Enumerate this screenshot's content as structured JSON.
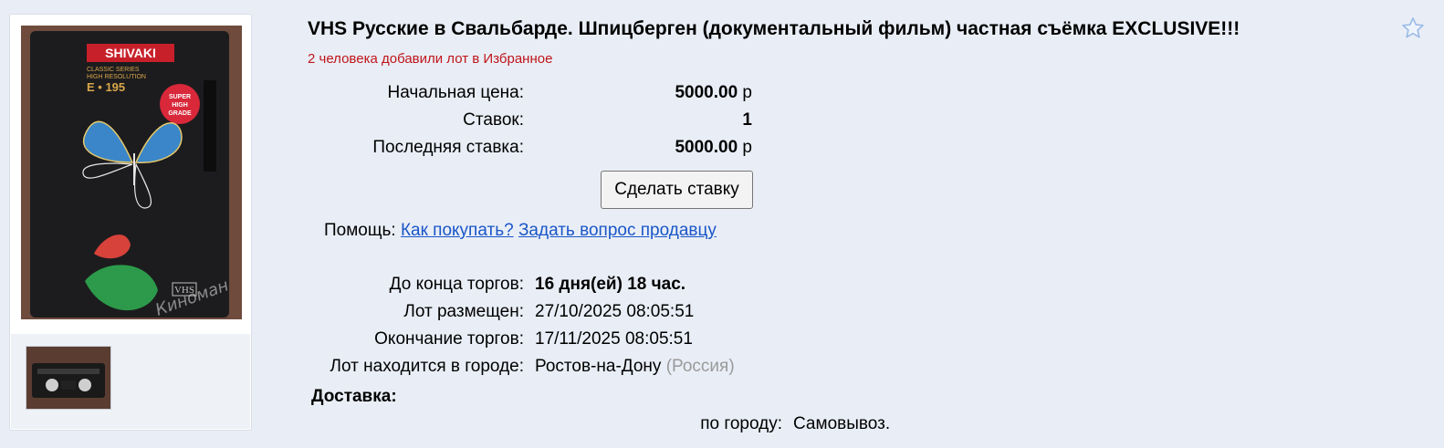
{
  "lot": {
    "title": "VHS Русские в Свальбарде. Шпицберген (документальный фильм) частная съёмка EXCLUSIVE!!!",
    "favorites_note": "2 человека добавили лот в Избранное"
  },
  "gallery": {
    "cassette_brand": "SHIVAKI",
    "cassette_series": "CLASSIC SERIES",
    "cassette_resolution": "HIGH RESOLUTION",
    "cassette_model": "E • 195",
    "cassette_badge_1": "SUPER",
    "cassette_badge_2": "HIGH",
    "cassette_badge_3": "GRADE",
    "cassette_vhs_logo": "VHS",
    "watermark": "Киноман"
  },
  "pricing": {
    "start_price_label": "Начальная цена:",
    "start_price_value": "5000.00",
    "currency": "р",
    "bids_label": "Ставок:",
    "bids_value": "1",
    "last_bid_label": "Последняя ставка:",
    "last_bid_value": "5000.00"
  },
  "actions": {
    "place_bid_label": "Сделать ставку",
    "help_label": "Помощь:",
    "how_to_buy_link": "Как покупать?",
    "ask_seller_link": "Задать вопрос продавцу"
  },
  "timing": {
    "ends_in_label": "До конца торгов:",
    "ends_in_value": "16 дня(ей) 18 час.",
    "posted_label": "Лот размещен:",
    "posted_value": "27/10/2025 08:05:51",
    "end_label": "Окончание торгов:",
    "end_value": "17/11/2025 08:05:51",
    "city_label": "Лот находится в городе:",
    "city_value": "Ростов-на-Дону",
    "country_value": "(Россия)"
  },
  "delivery": {
    "heading": "Доставка:",
    "city_label": "по городу:",
    "city_value": "Самовывоз."
  },
  "colors": {
    "page_bg": "#e9eef6",
    "accent_red": "#c0141a",
    "link_blue": "#1a56c8",
    "muted_gray": "#9a9a9a"
  }
}
